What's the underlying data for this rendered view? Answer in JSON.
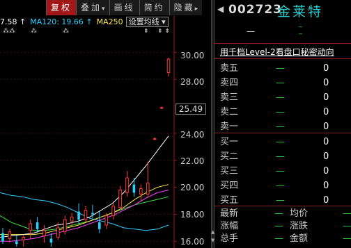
{
  "toolbar": {
    "tabs": [
      {
        "label": "复权",
        "active": true
      },
      {
        "label": "叠加",
        "caret": "▾",
        "active": false
      },
      {
        "label": "画线",
        "active": false
      },
      {
        "label": "简约",
        "active": false
      },
      {
        "label": "隐藏",
        "caret": "▸",
        "active": false
      }
    ]
  },
  "ma_bar": {
    "ma_prev": "7.58 ↑",
    "ma120": "MA120: 19.66 ↑",
    "ma250": "MA250",
    "setting_button": "设置均线",
    "setting_caret": "▾"
  },
  "markers": [
    "⁂⁂",
    "⁂",
    "⁂",
    "⇟",
    "⇟ ⇟"
  ],
  "axis": {
    "labels": [
      "30.00",
      "28.00",
      "24.00",
      "22.00",
      "20.00",
      "18.00",
      "16.00"
    ],
    "current_price": "25.49",
    "ylim": [
      15.5,
      31.2
    ]
  },
  "colors": {
    "up": "#ff3a3a",
    "down": "#2bd0ff",
    "ma5": "#ffffff",
    "ma10": "#ffe84a",
    "ma20": "#ff40ff",
    "ma60": "#40e040",
    "accent": "#a01818",
    "stock_name": "#2bd0d0"
  },
  "chart_data": {
    "type": "candlestick",
    "ylim": [
      15.5,
      31.2
    ],
    "candles": [
      {
        "o": 16.6,
        "h": 17.0,
        "l": 15.8,
        "c": 16.0
      },
      {
        "o": 16.2,
        "h": 16.9,
        "l": 15.9,
        "c": 16.7
      },
      {
        "o": 16.0,
        "h": 16.4,
        "l": 15.6,
        "c": 15.8
      },
      {
        "o": 16.1,
        "h": 16.5,
        "l": 15.6,
        "c": 16.3
      },
      {
        "o": 16.8,
        "h": 17.6,
        "l": 16.2,
        "c": 17.3
      },
      {
        "o": 17.4,
        "h": 17.8,
        "l": 16.6,
        "c": 16.9
      },
      {
        "o": 16.4,
        "h": 17.2,
        "l": 15.9,
        "c": 16.8
      },
      {
        "o": 16.2,
        "h": 16.6,
        "l": 15.6,
        "c": 15.9
      },
      {
        "o": 16.3,
        "h": 17.4,
        "l": 16.1,
        "c": 17.0
      },
      {
        "o": 16.7,
        "h": 17.9,
        "l": 16.5,
        "c": 17.6
      },
      {
        "o": 17.5,
        "h": 18.1,
        "l": 17.1,
        "c": 17.8
      },
      {
        "o": 18.2,
        "h": 18.8,
        "l": 17.3,
        "c": 17.6
      },
      {
        "o": 17.6,
        "h": 18.6,
        "l": 17.4,
        "c": 18.3
      },
      {
        "o": 18.1,
        "h": 18.7,
        "l": 17.7,
        "c": 18.0
      },
      {
        "o": 17.4,
        "h": 18.2,
        "l": 16.6,
        "c": 16.9
      },
      {
        "o": 17.2,
        "h": 18.1,
        "l": 16.9,
        "c": 17.9
      },
      {
        "o": 17.9,
        "h": 18.8,
        "l": 17.6,
        "c": 18.6
      },
      {
        "o": 18.5,
        "h": 20.1,
        "l": 18.3,
        "c": 19.8
      },
      {
        "o": 19.6,
        "h": 21.2,
        "l": 19.3,
        "c": 20.7
      },
      {
        "o": 20.2,
        "h": 20.7,
        "l": 19.3,
        "c": 19.6
      },
      {
        "o": 19.5,
        "h": 20.2,
        "l": 19.0,
        "c": 19.9
      },
      {
        "o": 19.5,
        "h": 21.9,
        "l": 19.2,
        "c": 20.3
      },
      {
        "o": 23.6,
        "h": 23.7,
        "l": 23.5,
        "c": 23.6
      },
      {
        "o": 25.9,
        "h": 26.0,
        "l": 25.8,
        "c": 25.9
      },
      {
        "o": 28.5,
        "h": 29.6,
        "l": 28.2,
        "c": 29.5
      }
    ],
    "ma5": [
      16.3,
      16.4,
      16.5,
      16.6,
      16.9,
      17.2,
      17.3,
      17.5,
      17.8,
      18.3,
      18.8,
      19.6,
      20.6,
      21.6,
      22.7,
      23.8
    ],
    "ma10": [
      16.5,
      16.5,
      16.5,
      16.5,
      16.6,
      16.8,
      17.0,
      17.2,
      17.5,
      17.8,
      18.1,
      18.5,
      19.1,
      19.6,
      20.0,
      20.2
    ],
    "ma20": [
      16.0,
      16.0,
      16.1,
      16.2,
      16.4,
      16.6,
      16.8,
      17.0,
      17.3,
      17.6,
      17.9,
      18.3,
      18.7,
      19.2,
      19.6,
      19.8
    ],
    "ma60": [
      17.9,
      17.4,
      17.1,
      16.8,
      16.8,
      16.9,
      17.1,
      17.3,
      17.5,
      17.8,
      18.1,
      18.4,
      18.7,
      18.9,
      19.1,
      19.3
    ],
    "ma120": [
      19.6,
      19.4,
      19.3,
      19.1,
      19.0,
      18.8,
      18.5,
      18.1,
      17.7,
      17.5,
      17.3,
      17.0,
      16.9,
      16.8,
      16.9,
      17.2
    ]
  },
  "quote": {
    "arrow": "◀",
    "code": "002723",
    "name": "金莱特",
    "dash1": "—",
    "dash2_top": "_",
    "dash2_bottom": "_",
    "level2_link": "用千档Level-2看盘口秘密动向",
    "asks": [
      {
        "label": "卖五",
        "price": "—",
        "vol": "0"
      },
      {
        "label": "卖四",
        "price": "—",
        "vol": "0"
      },
      {
        "label": "卖三",
        "price": "—",
        "vol": "0"
      },
      {
        "label": "卖二",
        "price": "—",
        "vol": "0"
      },
      {
        "label": "卖一",
        "price": "—",
        "vol": "0"
      }
    ],
    "bids": [
      {
        "label": "买一",
        "price": "—",
        "vol": "0"
      },
      {
        "label": "买二",
        "price": "—",
        "vol": "0"
      },
      {
        "label": "买三",
        "price": "—",
        "vol": "0"
      },
      {
        "label": "买四",
        "price": "—",
        "vol": "0"
      },
      {
        "label": "买五",
        "price": "—",
        "vol": "0"
      }
    ],
    "stats": [
      {
        "l1": "最新",
        "v1": "—",
        "l2": "均价",
        "v2": "—"
      },
      {
        "l1": "涨幅",
        "v1": "—",
        "l2": "涨跌",
        "v2": "—"
      },
      {
        "l1": "总手",
        "v1": "—",
        "l2": "金额",
        "v2": "—"
      }
    ]
  }
}
